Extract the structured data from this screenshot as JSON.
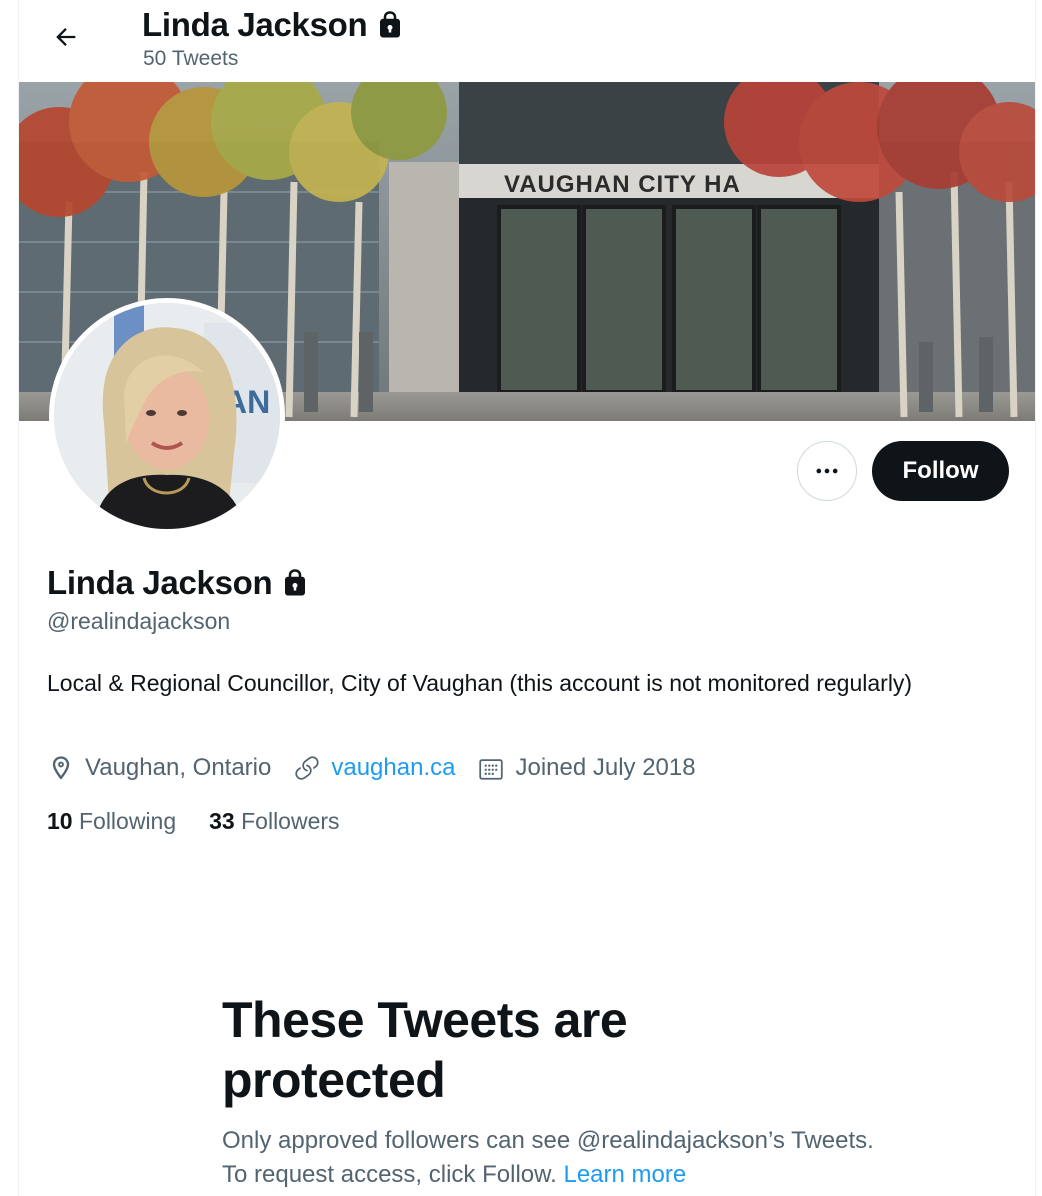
{
  "header": {
    "title": "Linda Jackson",
    "tweet_count": "50 Tweets",
    "back_icon": "arrow-left-icon"
  },
  "banner": {
    "sign_text": "VAUGHAN CITY HA"
  },
  "profile": {
    "name": "Linda Jackson",
    "handle": "@realindajackson",
    "bio": "Local & Regional Councillor, City of Vaughan (this account is not monitored regularly)",
    "location": "Vaughan, Ontario",
    "website": "vaughan.ca",
    "joined": "Joined July 2018",
    "following_count": "10",
    "following_label": "Following",
    "followers_count": "33",
    "followers_label": "Followers",
    "locked_icon": "lock-icon"
  },
  "actions": {
    "follow_label": "Follow",
    "more_icon": "more-options-icon"
  },
  "protected": {
    "title": "These Tweets are protected",
    "body": "Only approved followers can see @realindajackson’s Tweets. To request access, click Follow.",
    "learn_more": "Learn more"
  },
  "colors": {
    "text_primary": "#0f1419",
    "text_secondary": "#536471",
    "link": "#1d9bf0",
    "button_dark": "#0f1419"
  }
}
